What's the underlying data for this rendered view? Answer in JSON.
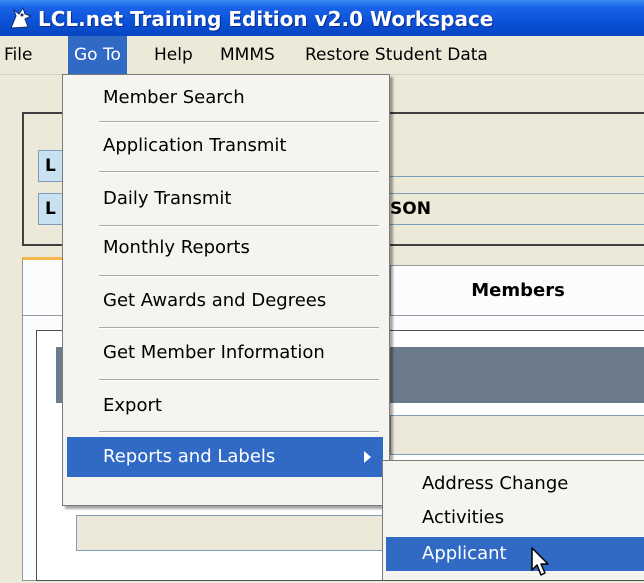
{
  "window": {
    "title": "LCL.net Training Edition v2.0 Workspace",
    "icon": "lcl-app-icon"
  },
  "menubar": {
    "items": [
      {
        "label": "File"
      },
      {
        "label": "Go To",
        "active": true
      },
      {
        "label": "Help"
      },
      {
        "label": "MMMS"
      },
      {
        "label": "Restore Student Data"
      }
    ]
  },
  "background": {
    "field1_label": "L",
    "field2_label": "L",
    "field2_value_fragment": "SON",
    "tab_members": "Members"
  },
  "goto_menu": {
    "items": [
      {
        "label": "Member Search"
      },
      {
        "label": "Application Transmit"
      },
      {
        "label": "Daily Transmit"
      },
      {
        "label": "Monthly Reports"
      },
      {
        "label": "Get Awards and Degrees"
      },
      {
        "label": "Get Member Information"
      },
      {
        "label": "Export"
      },
      {
        "label": "Reports and Labels",
        "highlighted": true,
        "has_submenu": true
      }
    ]
  },
  "reports_submenu": {
    "items": [
      {
        "label": "Address Change"
      },
      {
        "label": "Activities"
      },
      {
        "label": "Applicant",
        "highlighted": true
      }
    ]
  },
  "colors": {
    "titlebar": "#0a51d6",
    "highlight": "#316ac5",
    "menu_bg": "#f5f4ee",
    "window_bg": "#ece9d8",
    "tab_accent": "#f7b64a"
  }
}
